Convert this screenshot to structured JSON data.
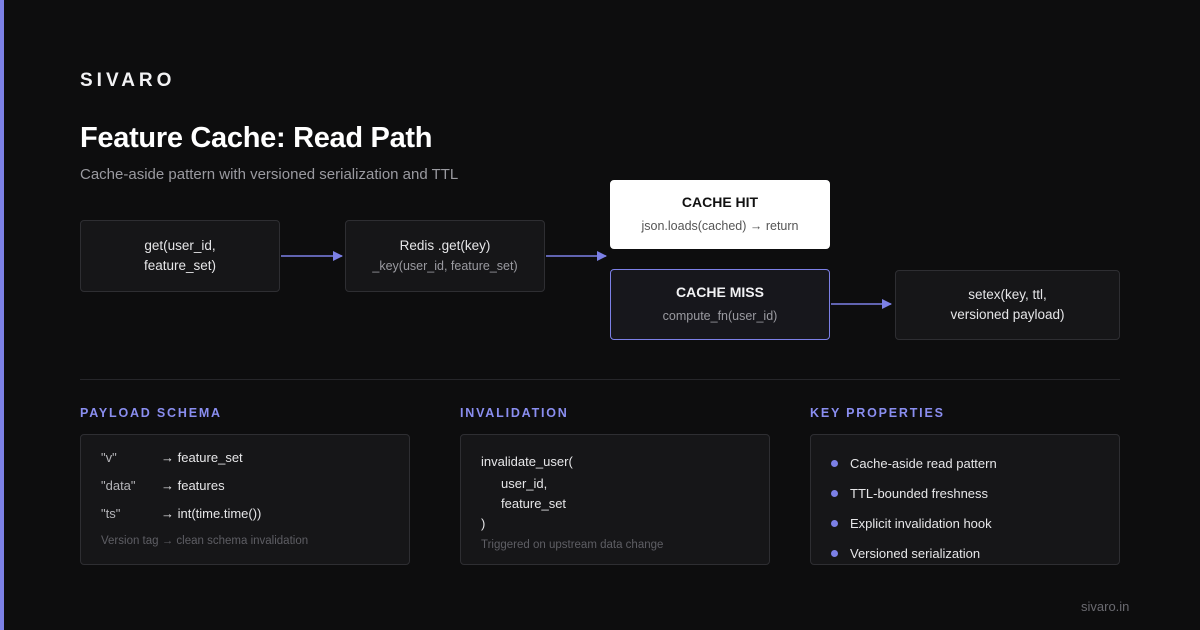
{
  "brand": "SIVARO",
  "title": "Feature Cache: Read Path",
  "subtitle": "Cache-aside pattern with versioned serialization and TTL",
  "flow": {
    "get": {
      "line1": "get(user_id,",
      "line2": "feature_set)"
    },
    "redis": {
      "line1": "Redis .get(key)",
      "line2": "_key(user_id, feature_set)"
    },
    "hit": {
      "head": "CACHE HIT",
      "sub": "json.loads(cached) → return"
    },
    "miss": {
      "head": "CACHE MISS",
      "sub": "compute_fn(user_id)"
    },
    "setex": {
      "line1": "setex(key, ttl,",
      "line2": "versioned payload)"
    }
  },
  "sections": {
    "schema": {
      "label": "PAYLOAD SCHEMA",
      "rows": [
        {
          "key": "\"v\"",
          "value": "→ feature_set"
        },
        {
          "key": "\"data\"",
          "value": "→ features"
        },
        {
          "key": "\"ts\"",
          "value": "→ int(time.time())"
        }
      ],
      "note": "Version tag → clean schema invalidation"
    },
    "invalidation": {
      "label": "INVALIDATION",
      "lines": [
        "invalidate_user(",
        "user_id,",
        "feature_set",
        ")"
      ],
      "note": "Triggered on upstream data change"
    },
    "properties": {
      "label": "KEY PROPERTIES",
      "items": [
        "Cache-aside read pattern",
        "TTL-bounded freshness",
        "Explicit invalidation hook",
        "Versioned serialization"
      ]
    }
  },
  "footer": "sivaro.in",
  "colors": {
    "accent": "#7c80e6",
    "label": "#8a8ef0",
    "background": "#0d0d0e"
  }
}
